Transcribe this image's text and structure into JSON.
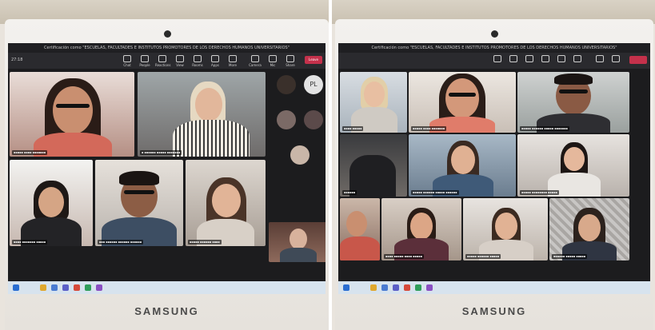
{
  "left": {
    "brand": "SAMSUNG",
    "meeting_title": "Certificación como \"ESCUELAS, FACULTADES E INSTITUTOS PROMOTORES DE LOS DERECHOS HUMANOS UNIVERSITARIOS\"",
    "toolbar": [
      "Chat",
      "People",
      "Reactions",
      "View",
      "Rooms",
      "Apps",
      "More",
      "Camera",
      "Mic",
      "Share"
    ],
    "leave": "Leave",
    "timer": "27:18",
    "avatar_initials": "PL"
  },
  "right": {
    "brand": "SAMSUNG",
    "meeting_title": "Certificación como \"ESCUELAS, FACULTADES E INSTITUTOS PROMOTORES DE LOS DERECHOS HUMANOS UNIVERSITARIOS\""
  },
  "colors": {
    "teams_leave": "#c4314b",
    "screen_bg": "#1c1c1e",
    "taskbar": "#d7e3ee"
  }
}
